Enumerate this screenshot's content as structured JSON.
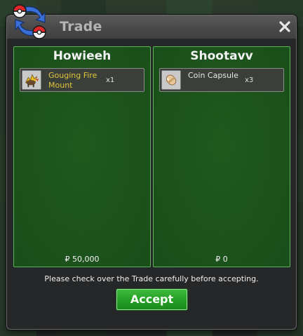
{
  "window": {
    "title": "Trade",
    "close_label": "×"
  },
  "left_panel": {
    "player_name": "Howieeh",
    "item": {
      "name": "Gouging Fire Mount",
      "quantity": "x1",
      "name_color": "#e0c43a",
      "icon": "gouging-fire-mount-icon"
    },
    "money": "₽ 50,000"
  },
  "right_panel": {
    "player_name": "Shootavv",
    "item": {
      "name": "Coin Capsule",
      "quantity": "x3",
      "name_color": "#e8e8e8",
      "icon": "coin-capsule-icon"
    },
    "money": "₽ 0"
  },
  "notice": "Please check over the Trade carefully before accepting.",
  "accept_label": "Accept",
  "colors": {
    "panel_green": "#1c531c",
    "panel_border": "#5bb35b",
    "button_green": "#26a026"
  }
}
